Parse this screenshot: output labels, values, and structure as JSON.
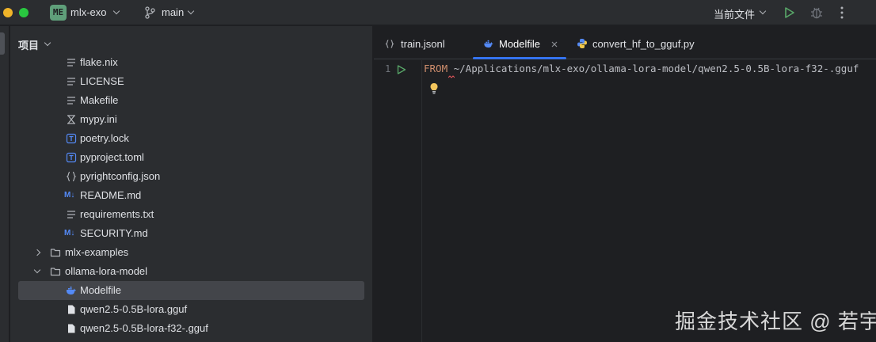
{
  "titlebar": {
    "project_badge": "ME",
    "project_name": "mlx-exo",
    "branch": "main",
    "current_file_label": "当前文件"
  },
  "panel": {
    "title": "项目",
    "tree": [
      {
        "label": "flake.nix",
        "icon": "text-lines-icon"
      },
      {
        "label": "LICENSE",
        "icon": "text-lines-icon"
      },
      {
        "label": "Makefile",
        "icon": "text-lines-icon"
      },
      {
        "label": "mypy.ini",
        "icon": "config-file-icon"
      },
      {
        "label": "poetry.lock",
        "icon": "toml-file-icon"
      },
      {
        "label": "pyproject.toml",
        "icon": "toml-file-icon"
      },
      {
        "label": "pyrightconfig.json",
        "icon": "json-file-icon"
      },
      {
        "label": "README.md",
        "icon": "markdown-file-icon"
      },
      {
        "label": "requirements.txt",
        "icon": "text-lines-icon"
      },
      {
        "label": "SECURITY.md",
        "icon": "markdown-file-icon"
      },
      {
        "label": "mlx-examples",
        "icon": "folder-icon"
      },
      {
        "label": "ollama-lora-model",
        "icon": "folder-icon"
      },
      {
        "label": "Modelfile",
        "icon": "docker-icon"
      },
      {
        "label": "qwen2.5-0.5B-lora.gguf",
        "icon": "blank-file-icon"
      },
      {
        "label": "qwen2.5-0.5B-lora-f32-.gguf",
        "icon": "blank-file-icon"
      }
    ],
    "md_badge": "M↓"
  },
  "editor": {
    "tabs": [
      {
        "label": "train.jsonl",
        "icon": "json-file-icon"
      },
      {
        "label": "Modelfile",
        "icon": "docker-icon",
        "active": true
      },
      {
        "label": "convert_hf_to_gguf.py",
        "icon": "python-icon"
      }
    ],
    "line_number": "1",
    "code_keyword": "FROM",
    "code_path": " ~/Applications/mlx-exo/ollama-lora-model/qwen2.5-0.5B-lora-f32-.gguf"
  },
  "watermark": "掘金技术社区 @ 若宇",
  "colors": {
    "accent": "#3574f0",
    "keyword": "#cf8e6d",
    "run_green": "#59a869"
  }
}
